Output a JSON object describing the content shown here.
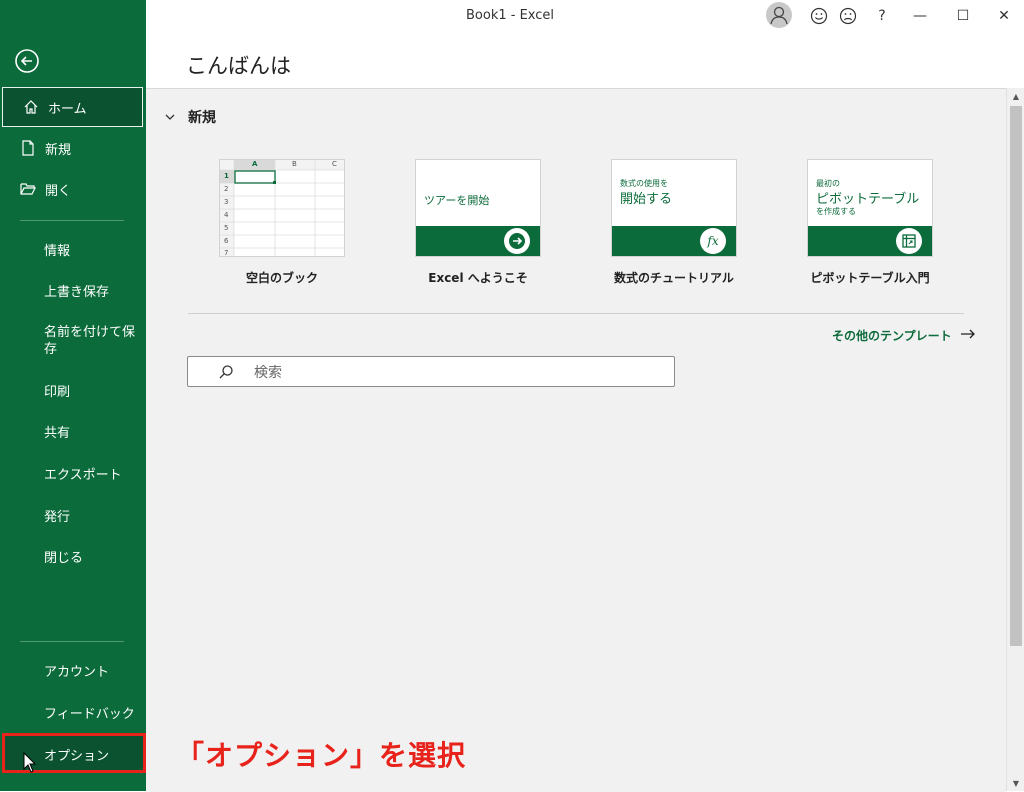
{
  "window": {
    "title": "Book1  -  Excel"
  },
  "titlebar_controls": [
    "?",
    "—",
    "☐",
    "✕"
  ],
  "sidebar": {
    "items": [
      {
        "label": "ホーム",
        "icon": "home-icon"
      },
      {
        "label": "新規",
        "icon": "new-file-icon"
      },
      {
        "label": "開く",
        "icon": "open-folder-icon"
      },
      {
        "label": "情報"
      },
      {
        "label": "上書き保存"
      },
      {
        "label": "名前を付けて保存"
      },
      {
        "label": "印刷"
      },
      {
        "label": "共有"
      },
      {
        "label": "エクスポート"
      },
      {
        "label": "発行"
      },
      {
        "label": "閉じる"
      },
      {
        "label": "アカウント"
      },
      {
        "label": "フィードバック"
      },
      {
        "label": "オプション"
      }
    ]
  },
  "header": {
    "greeting": "こんばんは"
  },
  "new_section": {
    "title": "新規",
    "templates": [
      {
        "label": "空白のブック",
        "cols": [
          "A",
          "B",
          "C"
        ],
        "rows": [
          "1",
          "2",
          "3",
          "4",
          "5",
          "6",
          "7"
        ]
      },
      {
        "label": "Excel へようこそ",
        "thumb_text": "ツアーを開始"
      },
      {
        "label": "数式のチュートリアル",
        "thumb_small": "数式の使用を",
        "thumb_big": "開始する",
        "badge": "fx"
      },
      {
        "label": "ピボットテーブル入門",
        "thumb_small": "最初の",
        "thumb_big": "ピボットテーブル",
        "thumb_small2": "を作成する"
      }
    ],
    "more_templates": "その他のテンプレート",
    "search_placeholder": "検索"
  },
  "annotation": "「オプション」を選択",
  "colors": {
    "accent": "#0b6b3a",
    "highlight": "#e8231b"
  }
}
